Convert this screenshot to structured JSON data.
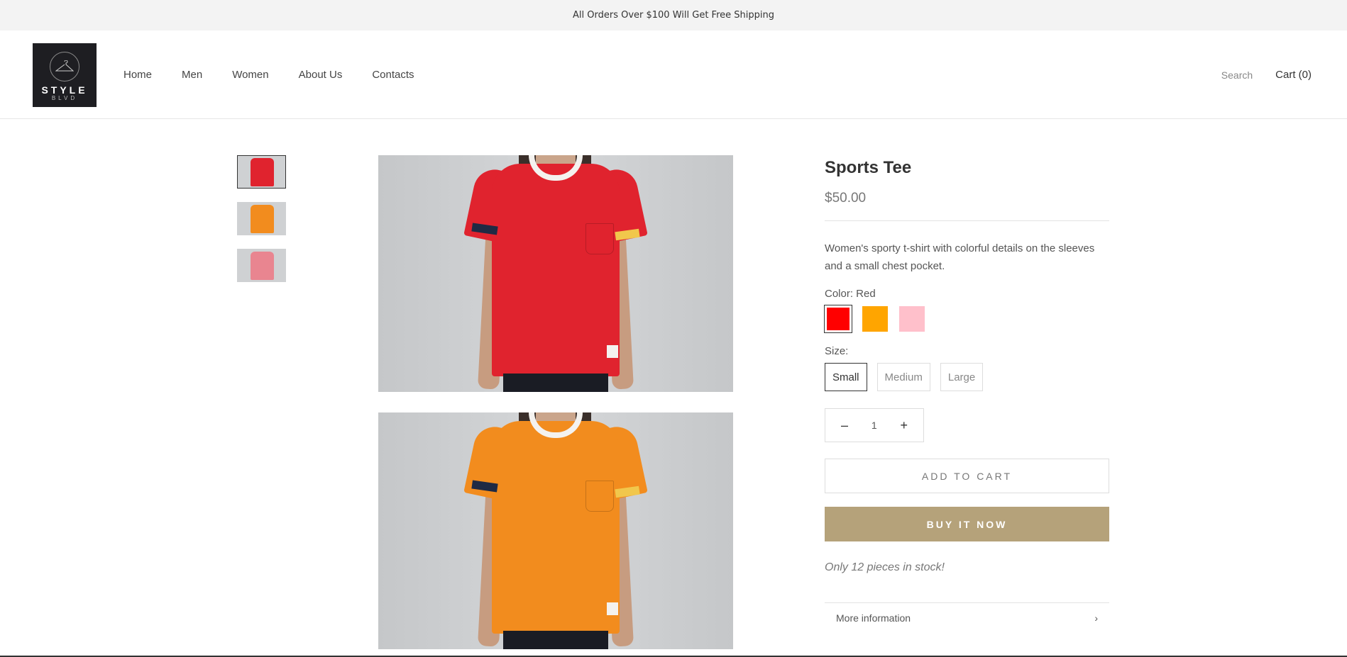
{
  "announcement": "All Orders Over $100 Will Get Free Shipping",
  "logo": {
    "main": "STYLE",
    "sub": "BLVD"
  },
  "nav": [
    {
      "label": "Home"
    },
    {
      "label": "Men"
    },
    {
      "label": "Women"
    },
    {
      "label": "About Us"
    },
    {
      "label": "Contacts"
    }
  ],
  "header_right": {
    "search": "Search",
    "cart": "Cart (0)"
  },
  "thumbnails": [
    {
      "color": "#e0232e"
    },
    {
      "color": "#f28c1e"
    },
    {
      "color": "#e98590"
    }
  ],
  "photos": [
    {
      "shirt_color": "#e0232e"
    },
    {
      "shirt_color": "#f28c1e"
    }
  ],
  "product": {
    "title": "Sports Tee",
    "price": "$50.00",
    "description": "Women's sporty t-shirt with colorful details on the sleeves and a small chest pocket.",
    "color_label": "Color: Red",
    "colors": [
      "#ff0000",
      "#ffa500",
      "#ffc0cb"
    ],
    "size_label": "Size:",
    "sizes": [
      "Small",
      "Medium",
      "Large"
    ],
    "quantity": "1",
    "qty_minus": "–",
    "qty_plus": "+",
    "add_to_cart": "ADD TO CART",
    "buy_now": "BUY IT NOW",
    "stock": "Only 12 pieces in stock!",
    "more_info": "More information",
    "more_chevron": "›"
  }
}
